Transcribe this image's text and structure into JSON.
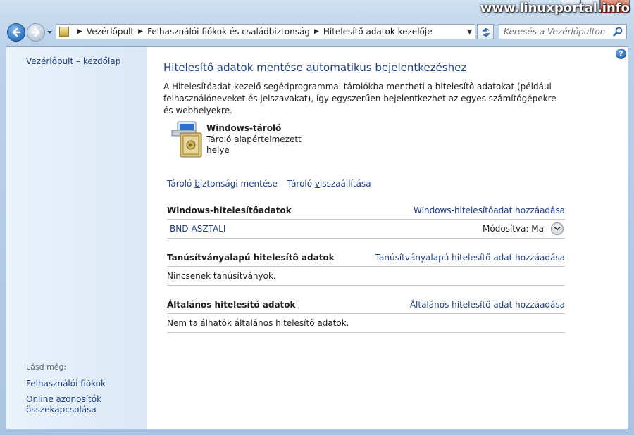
{
  "watermark": "www.linuxportal.info",
  "navbar": {
    "breadcrumb": [
      "Vezérlőpult",
      "Felhasználói fiókok és családbiztonság",
      "Hitelesítő adatok kezelője"
    ],
    "search_placeholder": "Keresés a Vezérlőpulton"
  },
  "sidebar": {
    "home": "Vezérlőpult – kezdőlap",
    "see_also": "Lásd még:",
    "links": [
      "Felhasználói fiókok",
      "Online azonosítók összekapcsolása"
    ]
  },
  "main": {
    "title": "Hitelesítő adatok mentése automatikus bejelentkezéshez",
    "intro": "A Hitelesítőadat-kezelő segédprogrammal tárolókba mentheti a hitelesítő adatokat (például felhasználóneveket és jelszavakat), így egyszerűen bejelentkezhet az egyes számítógépekre és webhelyekre.",
    "vault": {
      "name": "Windows-tároló",
      "description": "Tároló alapértelmezett helye"
    },
    "actions": {
      "backup_pre": "Tároló ",
      "backup_key": "b",
      "backup_post": "iztonsági mentése",
      "restore_pre": "Tároló ",
      "restore_key": "v",
      "restore_post": "isszaállítása"
    },
    "sections": {
      "windows": {
        "title": "Windows-hitelesítőadatok",
        "add": "Windows-hitelesítőadat hozzáadása",
        "item_name": "BND-ASZTALI",
        "item_modified": "Módosítva: Ma"
      },
      "cert": {
        "title": "Tanúsítványalapú hitelesítő adatok",
        "add": "Tanúsítványalapú hitelesítő adat hozzáadása",
        "empty": "Nincsenek tanúsítványok."
      },
      "generic": {
        "title": "Általános hitelesítő adatok",
        "add": "Általános hitelesítő adat hozzáadása",
        "empty": "Nem találhatók általános hitelesítő adatok."
      }
    }
  }
}
